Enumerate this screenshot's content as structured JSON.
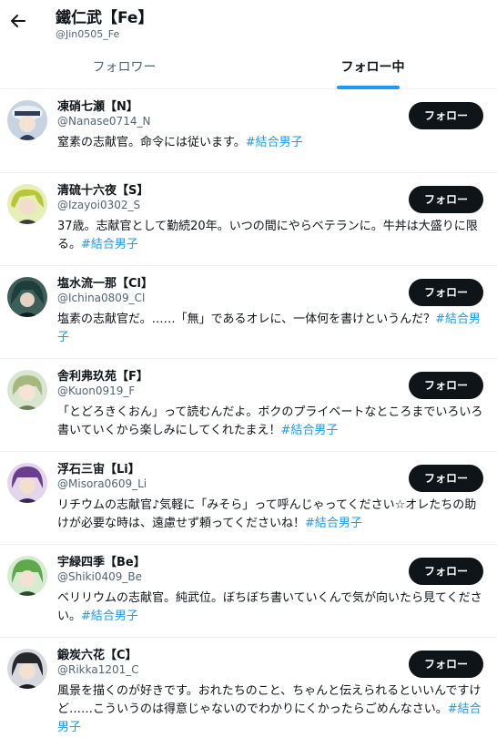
{
  "header": {
    "back_icon": "arrow-left-icon",
    "name": "鐵仁武【Fe】",
    "handle": "@Jin0505_Fe"
  },
  "tabs": [
    {
      "label": "フォロワー",
      "active": false
    },
    {
      "label": "フォロー中",
      "active": true
    }
  ],
  "colors": {
    "accent": "#1d9bf0",
    "button": "#0f1419",
    "muted": "#536471"
  },
  "users": [
    {
      "name": "凍硝七瀬【N】",
      "handle": "@Nanase0714_N",
      "bio": "窒素の志献官。命令には従います。",
      "tag": "#結合男子",
      "button": "フォロー"
    },
    {
      "name": "清硫十六夜【S】",
      "handle": "@Izayoi0302_S",
      "bio": "37歳。志献官として勤続20年。いつの間にやらベテランに。牛丼は大盛りに限る。",
      "tag": "#結合男子",
      "button": "フォロー"
    },
    {
      "name": "塩水流一那【Cl】",
      "handle": "@Ichina0809_Cl",
      "bio": "塩素の志献官だ。……「無」であるオレに、一体何を書けというんだ？",
      "tag": "#結合男子",
      "button": "フォロー"
    },
    {
      "name": "舎利弗玖苑【F】",
      "handle": "@Kuon0919_F",
      "bio": "「とどろきくおん」って読むんだよ。ボクのプライベートなところまでいろいろ書いていくから楽しみにしてくれたまえ！",
      "tag": "#結合男子",
      "button": "フォロー"
    },
    {
      "name": "浮石三宙【Li】",
      "handle": "@Misora0609_Li",
      "bio": "リチウムの志献官♪気軽に「みそら」って呼んじゃってください☆オレたちの助けが必要な時は、遠慮せず頼ってくださいね！",
      "tag": "#結合男子",
      "button": "フォロー"
    },
    {
      "name": "宇緑四季【Be】",
      "handle": "@Shiki0409_Be",
      "bio": "ベリリウムの志献官。純武位。ぼちぼち書いていくんで気が向いたら見てください。",
      "tag": "#結合男子",
      "button": "フォロー"
    },
    {
      "name": "鍛炭六花【C】",
      "handle": "@Rikka1201_C",
      "bio": "風景を描くのが好きです。おれたちのこと、ちゃんと伝えられるといいんですけど……こういうのは得意じゃないのでわかりにくかったらごめんなさい。",
      "tag": "#結合男子",
      "button": "フォロー"
    }
  ]
}
